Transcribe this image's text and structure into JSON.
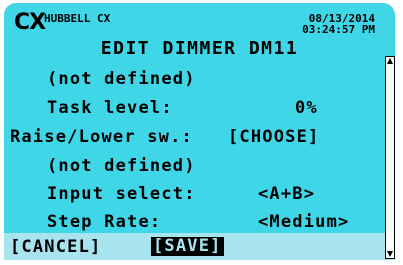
{
  "header": {
    "logo_text": "CX",
    "brand": "HUBBELL CX",
    "date": "08/13/2014",
    "time": "03:24:57 PM"
  },
  "title": "EDIT DIMMER DM11",
  "rows": [
    {
      "label": "(not defined)",
      "value": ""
    },
    {
      "label": "Task level:",
      "value": "0%"
    },
    {
      "label": "Raise/Lower sw.:",
      "value": "[CHOOSE]"
    },
    {
      "label": "(not defined)",
      "value": ""
    },
    {
      "label": "Input select:",
      "value": "<A+B>"
    },
    {
      "label": "Step Rate:",
      "value": "<Medium>"
    }
  ],
  "footer": {
    "cancel_label": "[CANCEL]",
    "save_label": "[SAVE]"
  },
  "colors": {
    "screen_bg": "#3fd6e8",
    "footer_bg": "#a8e4ee",
    "text": "#000000"
  }
}
